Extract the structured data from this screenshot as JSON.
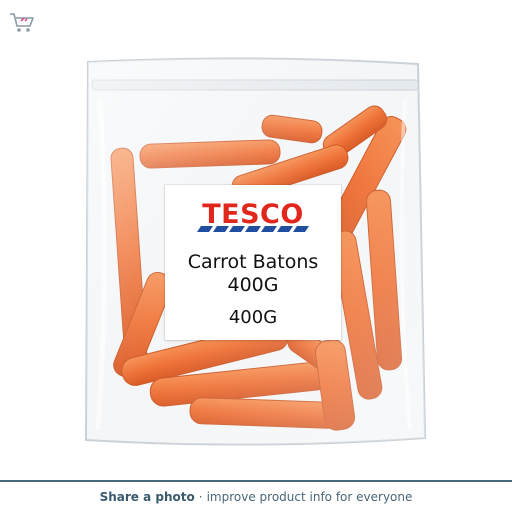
{
  "header": {
    "cart_icon": "cart-icon"
  },
  "product_image": {
    "label": {
      "brand": "TESCO",
      "name": "Carrot Batons",
      "weight_line_1": "400G",
      "weight_line_2": "400G"
    },
    "colors": {
      "brand_red": "#e1261c",
      "brand_blue": "#1f4f9e",
      "carrot": "#ee6a2c"
    }
  },
  "footer": {
    "share_label": "Share a photo",
    "separator": "·",
    "tagline": "improve product info for everyone",
    "border_color": "#46697e"
  }
}
